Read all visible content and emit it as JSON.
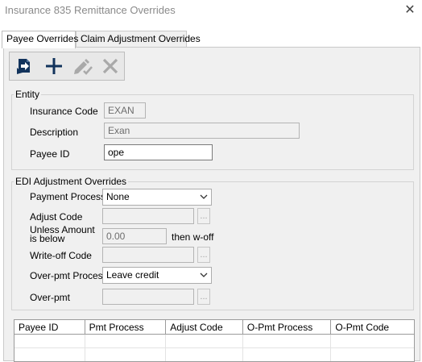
{
  "window": {
    "title": "Insurance 835 Remittance Overrides",
    "close_label": "✕"
  },
  "tabs": [
    {
      "label": "Payee Overrides"
    },
    {
      "label": "Claim Adjustment Overrides"
    }
  ],
  "toolbar": {
    "icons": [
      "open-icon",
      "add-icon",
      "edit-icon",
      "delete-icon"
    ]
  },
  "entity": {
    "title": "Entity",
    "insurance_code_label": "Insurance Code",
    "insurance_code_value": "EXAN",
    "description_label": "Description",
    "description_value": "Exan",
    "payee_id_label": "Payee ID",
    "payee_id_value": "ope"
  },
  "edi": {
    "title": "EDI Adjustment Overrides",
    "payment_process_label": "Payment Process",
    "payment_process_value": "None",
    "adjust_code_label": "Adjust Code",
    "adjust_code_value": "",
    "unless_amount_label": "Unless Amount is below",
    "unless_amount_value": "0.00",
    "then_woff_label": "then w-off",
    "writeoff_code_label": "Write-off Code",
    "writeoff_code_value": "",
    "overpmt_process_label": "Over-pmt Process",
    "overpmt_process_value": "Leave credit",
    "overpmt_label": "Over-pmt",
    "overpmt_value": "",
    "ellipsis_label": "..."
  },
  "grid": {
    "columns": [
      "Payee ID",
      "Pmt Process",
      "Adjust Code",
      "O-Pmt Process",
      "O-Pmt Code"
    ],
    "rows": []
  },
  "colors": {
    "panel": "#f0f0f0",
    "icon_dark": "#12335c",
    "icon_disabled": "#a9a9a9"
  }
}
